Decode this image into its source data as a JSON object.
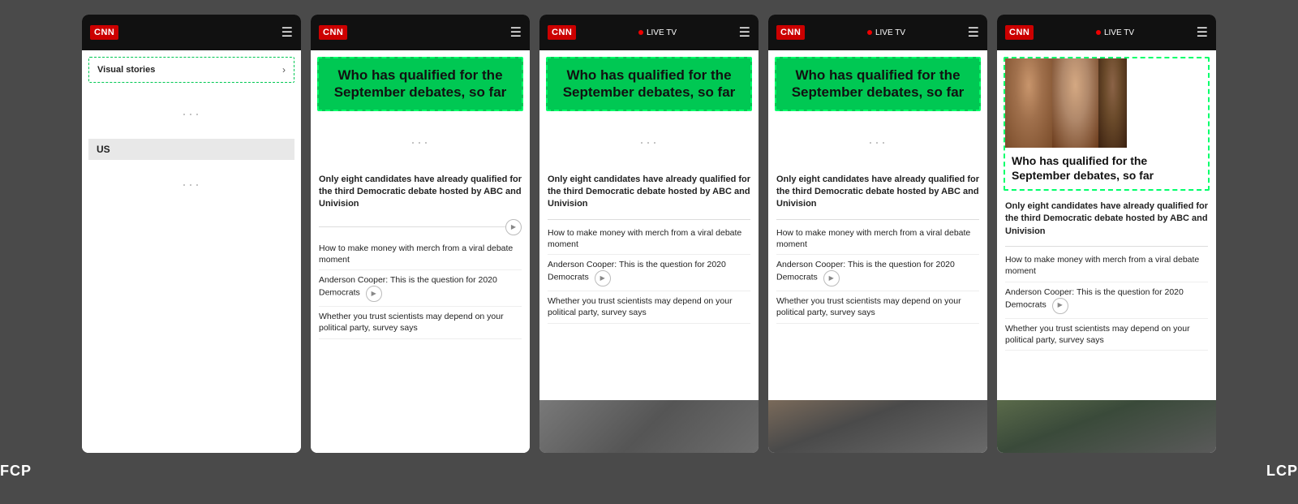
{
  "background": "#4a4a4a",
  "labels": {
    "fcp": "FCP",
    "lcp": "LCP"
  },
  "cnn_logo": "CNN",
  "phones": [
    {
      "id": "phone1",
      "type": "blank",
      "has_live_tv": false,
      "visual_stories_label": "Visual stories",
      "us_section_label": "US",
      "dots": "···",
      "dots2": "···"
    },
    {
      "id": "phone2",
      "type": "article",
      "has_live_tv": false,
      "headline": "Who has qualified for the September debates, so far",
      "main_text": "Only eight candidates have already qualified for the third Democratic debate hosted by ABC and Univision",
      "articles": [
        {
          "text": "How to make money with merch from a viral debate moment",
          "has_play": false
        },
        {
          "text": "Anderson Cooper: This is the question for 2020 Democrats",
          "has_play": true
        },
        {
          "text": "Whether you trust scientists may depend on your political party, survey says",
          "has_play": false
        }
      ],
      "has_bottom_image": false,
      "has_video_row": true,
      "dots": "···"
    },
    {
      "id": "phone3",
      "type": "article",
      "has_live_tv": true,
      "headline": "Who has qualified for the September debates, so far",
      "main_text": "Only eight candidates have already qualified for the third Democratic debate hosted by ABC and Univision",
      "articles": [
        {
          "text": "How to make money with merch from a viral debate moment",
          "has_play": false
        },
        {
          "text": "Anderson Cooper: This is the question for 2020 Democrats",
          "has_play": true
        },
        {
          "text": "Whether you trust scientists may depend on your political party, survey says",
          "has_play": false
        }
      ],
      "has_bottom_image": true,
      "dots": "···"
    },
    {
      "id": "phone4",
      "type": "article",
      "has_live_tv": true,
      "headline": "Who has qualified for the September debates, so far",
      "main_text": "Only eight candidates have already qualified for the third Democratic debate hosted by ABC and Univision",
      "articles": [
        {
          "text": "How to make money with merch from a viral debate moment",
          "has_play": false
        },
        {
          "text": "Anderson Cooper: This is the question for 2020 Democrats",
          "has_play": true
        },
        {
          "text": "Whether you trust scientists may depend on your political party, survey says",
          "has_play": false
        }
      ],
      "has_bottom_image": true,
      "dots": "···"
    },
    {
      "id": "phone5",
      "type": "lcp",
      "has_live_tv": true,
      "headline": "Who has qualified for the September debates, so far",
      "main_text": "Only eight candidates have already qualified for the third Democratic debate hosted by ABC and Univision",
      "articles": [
        {
          "text": "How to make money with merch from a viral debate moment",
          "has_play": false
        },
        {
          "text": "Anderson Cooper: This is the question for 2020 Democrats",
          "has_play": true
        },
        {
          "text": "Whether you trust scientists may depend on your political party, survey says",
          "has_play": false
        }
      ],
      "has_bottom_image": true,
      "dots": "···"
    }
  ]
}
